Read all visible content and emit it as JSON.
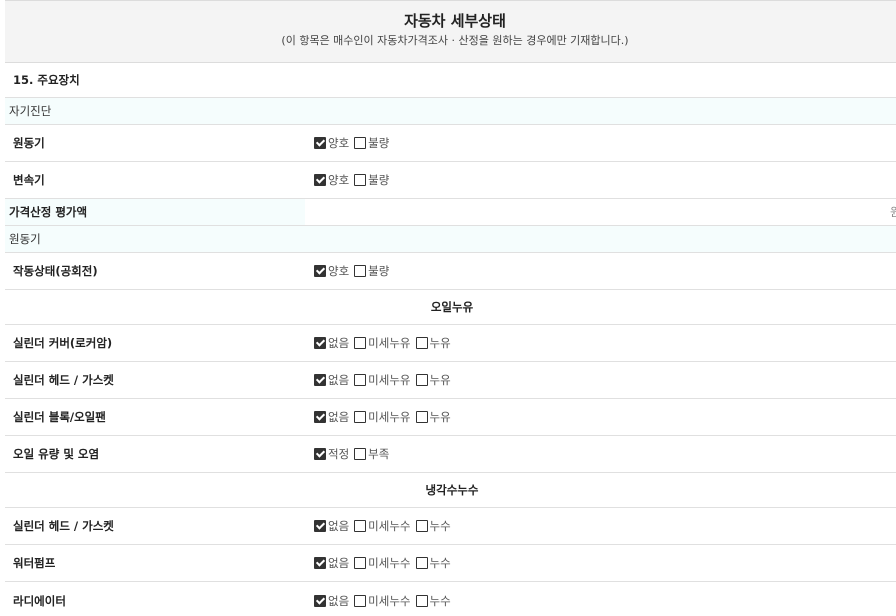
{
  "header": {
    "title": "자동차 세부상태",
    "subtitle": "(이 항목은 매수인이 자동차가격조사 · 산정을 원하는 경우에만 기재합니다.)"
  },
  "section_main": "15. 주요장치",
  "self_diag": {
    "label": "자기진단",
    "rows": [
      {
        "label": "원동기",
        "options": [
          {
            "text": "양호",
            "checked": true
          },
          {
            "text": "불량",
            "checked": false
          }
        ]
      },
      {
        "label": "변속기",
        "options": [
          {
            "text": "양호",
            "checked": true
          },
          {
            "text": "불량",
            "checked": false
          }
        ]
      }
    ]
  },
  "price": {
    "label": "가격산정 평가액",
    "unit": "원"
  },
  "engine": {
    "label": "원동기",
    "idle_row": {
      "label": "작동상태(공회전)",
      "options": [
        {
          "text": "양호",
          "checked": true
        },
        {
          "text": "불량",
          "checked": false
        }
      ]
    },
    "oil_title": "오일누유",
    "oil_rows": [
      {
        "label": "실린더 커버(로커암)",
        "options": [
          {
            "text": "없음",
            "checked": true
          },
          {
            "text": "미세누유",
            "checked": false
          },
          {
            "text": "누유",
            "checked": false
          }
        ]
      },
      {
        "label": "실린더 헤드 / 가스켓",
        "options": [
          {
            "text": "없음",
            "checked": true
          },
          {
            "text": "미세누유",
            "checked": false
          },
          {
            "text": "누유",
            "checked": false
          }
        ]
      },
      {
        "label": "실린더 블록/오일팬",
        "options": [
          {
            "text": "없음",
            "checked": true
          },
          {
            "text": "미세누유",
            "checked": false
          },
          {
            "text": "누유",
            "checked": false
          }
        ]
      },
      {
        "label": "오일 유량 및 오염",
        "options": [
          {
            "text": "적정",
            "checked": true
          },
          {
            "text": "부족",
            "checked": false
          }
        ]
      }
    ],
    "coolant_title": "냉각수누수",
    "coolant_rows": [
      {
        "label": "실린더 헤드 / 가스켓",
        "options": [
          {
            "text": "없음",
            "checked": true
          },
          {
            "text": "미세누수",
            "checked": false
          },
          {
            "text": "누수",
            "checked": false
          }
        ]
      },
      {
        "label": "워터펌프",
        "options": [
          {
            "text": "없음",
            "checked": true
          },
          {
            "text": "미세누수",
            "checked": false
          },
          {
            "text": "누수",
            "checked": false
          }
        ]
      },
      {
        "label": "라디에이터",
        "options": [
          {
            "text": "없음",
            "checked": true
          },
          {
            "text": "미세누수",
            "checked": false
          },
          {
            "text": "누수",
            "checked": false
          }
        ]
      }
    ]
  }
}
